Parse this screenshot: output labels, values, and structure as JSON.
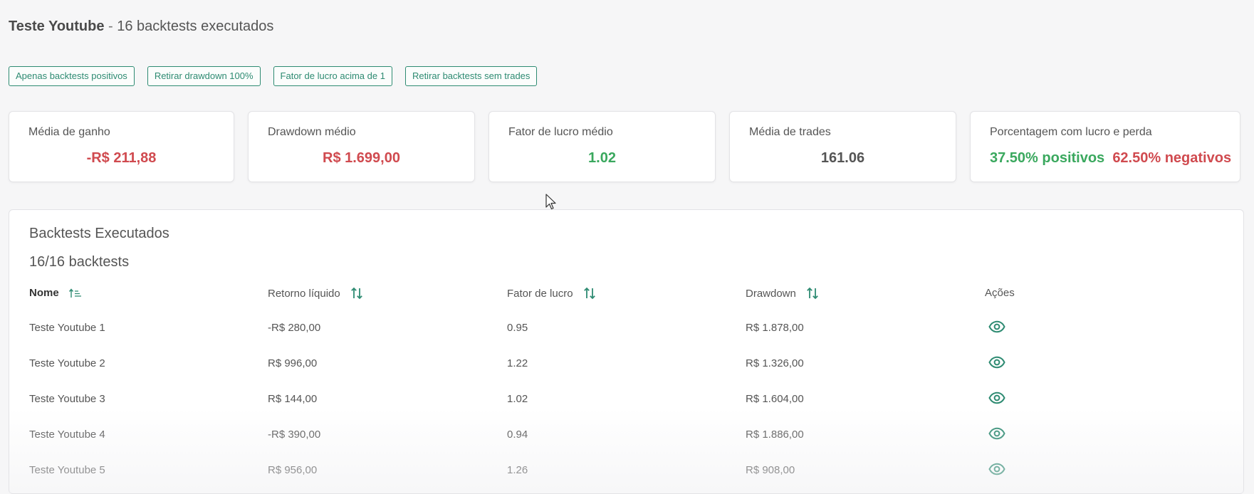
{
  "header": {
    "title": "Teste Youtube",
    "separator": " - ",
    "subtitle": "16 backtests executados"
  },
  "filters": [
    {
      "label": "Apenas backtests positivos"
    },
    {
      "label": "Retirar drawdown 100%"
    },
    {
      "label": "Fator de lucro acima de 1"
    },
    {
      "label": "Retirar backtests sem trades"
    }
  ],
  "stats": {
    "avg_gain": {
      "label": "Média de ganho",
      "value": "-R$ 211,88"
    },
    "avg_drawdown": {
      "label": "Drawdown médio",
      "value": "R$ 1.699,00"
    },
    "avg_profit_factor": {
      "label": "Fator de lucro médio",
      "value": "1.02"
    },
    "avg_trades": {
      "label": "Média de trades",
      "value": "161.06"
    },
    "profit_loss_pct": {
      "label": "Porcentagem com lucro e perda",
      "positive": "37.50% positivos",
      "negative": "62.50% negativos"
    }
  },
  "table": {
    "title": "Backtests Executados",
    "count": "16/16 backtests",
    "columns": {
      "name": "Nome",
      "net_return": "Retorno líquido",
      "profit_factor": "Fator de lucro",
      "drawdown": "Drawdown",
      "actions": "Ações"
    },
    "rows": [
      {
        "name": "Teste Youtube 1",
        "net_return": "-R$ 280,00",
        "profit_factor": "0.95",
        "drawdown": "R$ 1.878,00"
      },
      {
        "name": "Teste Youtube 2",
        "net_return": "R$ 996,00",
        "profit_factor": "1.22",
        "drawdown": "R$ 1.326,00"
      },
      {
        "name": "Teste Youtube 3",
        "net_return": "R$ 144,00",
        "profit_factor": "1.02",
        "drawdown": "R$ 1.604,00"
      },
      {
        "name": "Teste Youtube 4",
        "net_return": "-R$ 390,00",
        "profit_factor": "0.94",
        "drawdown": "R$ 1.886,00"
      },
      {
        "name": "Teste Youtube 5",
        "net_return": "R$ 956,00",
        "profit_factor": "1.26",
        "drawdown": "R$ 908,00"
      }
    ]
  },
  "colors": {
    "accent": "#2e8b72",
    "positive": "#3aa85e",
    "negative": "#d04a4f"
  },
  "icons": {
    "sort_name": "sort-ascending-icon",
    "sort_columns": "sort-arrows-icon",
    "view": "eye-icon"
  }
}
